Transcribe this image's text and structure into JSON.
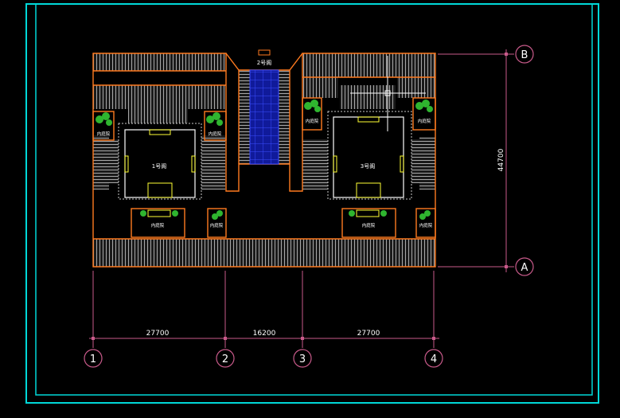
{
  "drawing": {
    "buildings": {
      "b1": "1号阁",
      "b2": "2号阁",
      "b3": "3号阁"
    },
    "courtyard_label": "内庭院",
    "dimensions": {
      "span_1_2": "27700",
      "span_2_3": "16200",
      "span_3_4": "27700",
      "height_A_B": "44700"
    },
    "grid_axes": {
      "columns": [
        "1",
        "2",
        "3",
        "4"
      ],
      "rows": [
        "A",
        "B"
      ]
    }
  },
  "colors": {
    "background": "#000000",
    "frame": "#00d8d8",
    "wall": "#ff7a1f",
    "roof": "#b4b4b4",
    "dimension": "#c85a8a",
    "stair": "#ffff33",
    "water": "#1a2bff",
    "tree": "#2fb52f"
  }
}
